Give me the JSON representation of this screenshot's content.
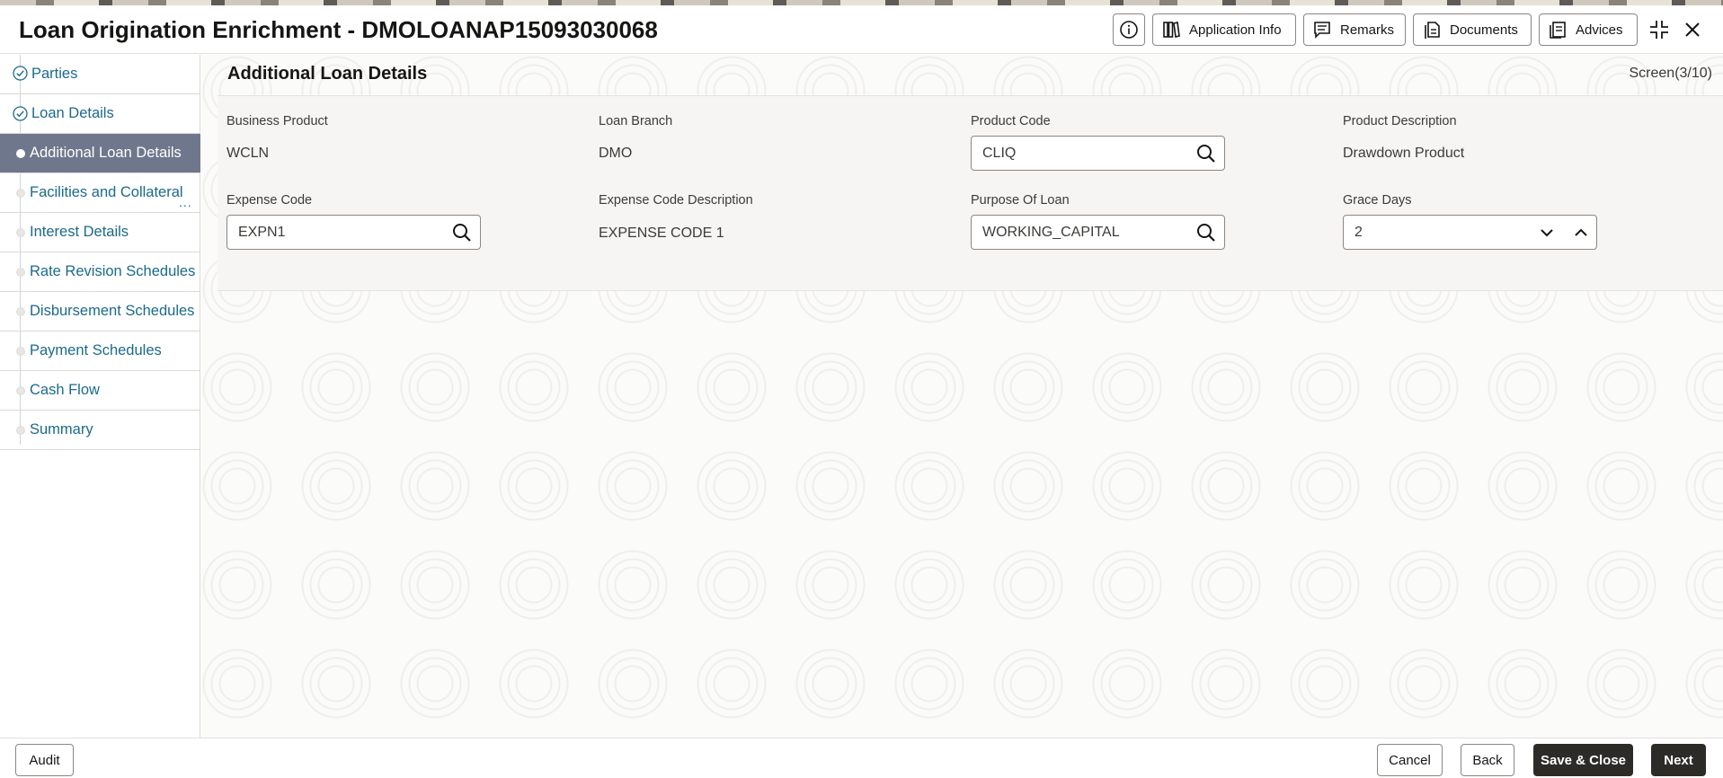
{
  "header": {
    "title": "Loan Origination Enrichment - DMOLOANAP15093030068",
    "buttons": {
      "application_info": "Application Info",
      "remarks": "Remarks",
      "documents": "Documents",
      "advices": "Advices"
    },
    "icons": [
      "info-icon",
      "application-info-icon",
      "remarks-icon",
      "documents-icon",
      "advices-icon",
      "minimize-icon",
      "close-icon"
    ]
  },
  "sidebar": {
    "items": [
      {
        "label": "Parties",
        "state": "completed"
      },
      {
        "label": "Loan Details",
        "state": "completed"
      },
      {
        "label": "Additional Loan Details",
        "state": "active"
      },
      {
        "label": "Facilities and Collateral",
        "state": "pending",
        "more": "..."
      },
      {
        "label": "Interest Details",
        "state": "pending"
      },
      {
        "label": "Rate Revision Schedules",
        "state": "pending"
      },
      {
        "label": "Disbursement Schedules",
        "state": "pending"
      },
      {
        "label": "Payment Schedules",
        "state": "pending"
      },
      {
        "label": "Cash Flow",
        "state": "pending"
      },
      {
        "label": "Summary",
        "state": "pending"
      }
    ]
  },
  "main": {
    "section_title": "Additional Loan Details",
    "screen_indicator": "Screen(3/10)",
    "fields": {
      "business_product": {
        "label": "Business Product",
        "value": "WCLN"
      },
      "loan_branch": {
        "label": "Loan Branch",
        "value": "DMO"
      },
      "product_code": {
        "label": "Product Code",
        "value": "CLIQ"
      },
      "product_description": {
        "label": "Product Description",
        "value": "Drawdown Product"
      },
      "expense_code": {
        "label": "Expense Code",
        "value": "EXPN1"
      },
      "expense_code_description": {
        "label": "Expense Code Description",
        "value": "EXPENSE CODE 1"
      },
      "purpose_of_loan": {
        "label": "Purpose Of Loan",
        "value": "WORKING_CAPITAL"
      },
      "grace_days": {
        "label": "Grace Days",
        "value": "2"
      }
    }
  },
  "footer": {
    "audit": "Audit",
    "cancel": "Cancel",
    "back": "Back",
    "save_close": "Save & Close",
    "next": "Next"
  },
  "colors": {
    "active_nav_bg": "#6f778c",
    "link_text": "#1b6a8c",
    "primary_button": "#2d2b28"
  }
}
